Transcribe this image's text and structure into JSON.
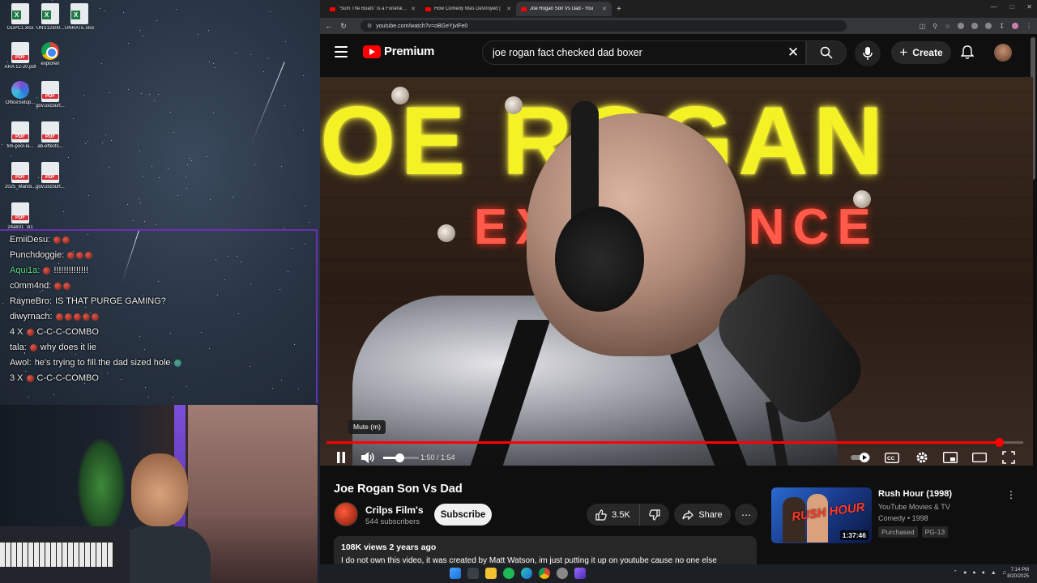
{
  "desktop": {
    "icons": [
      {
        "label": "GDPC1.xlsx",
        "type": "xls"
      },
      {
        "label": "UNS12300...",
        "type": "xls"
      },
      {
        "label": "UNRATE.xlsx",
        "type": "xls"
      },
      {
        "label": "ARA 12-20.pdf",
        "type": "pdf"
      },
      {
        "label": "exploren",
        "type": "chrome"
      },
      {
        "label": "OfficeSetup...",
        "type": "office"
      },
      {
        "label": "gov.uscourt...",
        "type": "pdf"
      },
      {
        "label": "tim-pool-la...",
        "type": "pdf"
      },
      {
        "label": "ab-effects...",
        "type": "pdf"
      },
      {
        "label": "2025_Mandi...",
        "type": "pdf"
      },
      {
        "label": "gov.uscourt...",
        "type": "pdf"
      },
      {
        "label": "24a831_3i1",
        "type": "pdf"
      }
    ]
  },
  "chat": {
    "messages": [
      {
        "user": "EmiiDesu:",
        "text": "",
        "emotes": 2,
        "color": "white"
      },
      {
        "user": "Punchdoggie:",
        "text": "",
        "emotes": 3,
        "color": "white"
      },
      {
        "user": "Aqui1a:",
        "text": "!!!!!!!!!!!!!!",
        "emotes": 1,
        "color": "green"
      },
      {
        "user": "c0mm4nd:",
        "text": "",
        "emotes": 2,
        "color": "white"
      },
      {
        "user": "RayneBro:",
        "text": "IS THAT PURGE GAMING?",
        "emotes": 0,
        "color": "white"
      },
      {
        "user": "diwyrnach:",
        "text": "",
        "emotes": 5,
        "color": "white"
      },
      {
        "user": "4 X",
        "text": "C-C-C-COMBO",
        "emotes": 1,
        "color": "white"
      },
      {
        "user": "tala:",
        "text": "why does it lie",
        "emotes": 1,
        "color": "white"
      },
      {
        "user": "Awol:",
        "text": "he's trying to fill the dad sized hole",
        "emotes": 0,
        "color": "white"
      },
      {
        "user": "3 X",
        "text": "C-C-C-COMBO",
        "emotes": 1,
        "color": "white"
      }
    ]
  },
  "browser": {
    "tabs": [
      {
        "title": "\"Sum The Boats\" is a Funeral M",
        "active": false
      },
      {
        "title": "How Comedy Was Destroyed |",
        "active": false
      },
      {
        "title": "Joe Rogan Son Vs Dad - You",
        "active": true
      }
    ],
    "new_tab": "+",
    "url": "youtube.com/watch?v=oBGeYjviFe0"
  },
  "youtube": {
    "logo_text": "Premium",
    "search_value": "joe rogan fact checked dad boxer",
    "create_label": "Create",
    "video": {
      "sign_top": "OE ROGAN",
      "sign_bottom": "EXPERIENCE",
      "tooltip": "Mute (m)",
      "time": "1:50 / 1:54",
      "progress": 0.965,
      "volume": 0.45
    },
    "title": "Joe Rogan Son Vs Dad",
    "channel": {
      "name": "Crilps Film's",
      "subscribers": "544 subscribers",
      "subscribe_label": "Subscribe"
    },
    "actions": {
      "likes": "3.5K",
      "share_label": "Share",
      "more_label": "⋯"
    },
    "description": {
      "meta": "108K views  2 years ago",
      "text": "I do not own this video, it was created by Matt Watson, im just putting it up on youtube cause no one else"
    },
    "recommendation": {
      "title": "Rush Hour (1998)",
      "channel": "YouTube Movies & TV",
      "meta": "Comedy • 1998",
      "badges": [
        "Purchased",
        "PG-13"
      ],
      "duration": "1:37:46",
      "thumb_text": "RUSH HOUR"
    }
  },
  "taskbar": {
    "time": "7:14 PM",
    "date": "8/20/2025"
  },
  "colors": {
    "brand_red": "#ff0000",
    "chat_border": "#6a2fb0",
    "chat_green": "#5be08a"
  }
}
